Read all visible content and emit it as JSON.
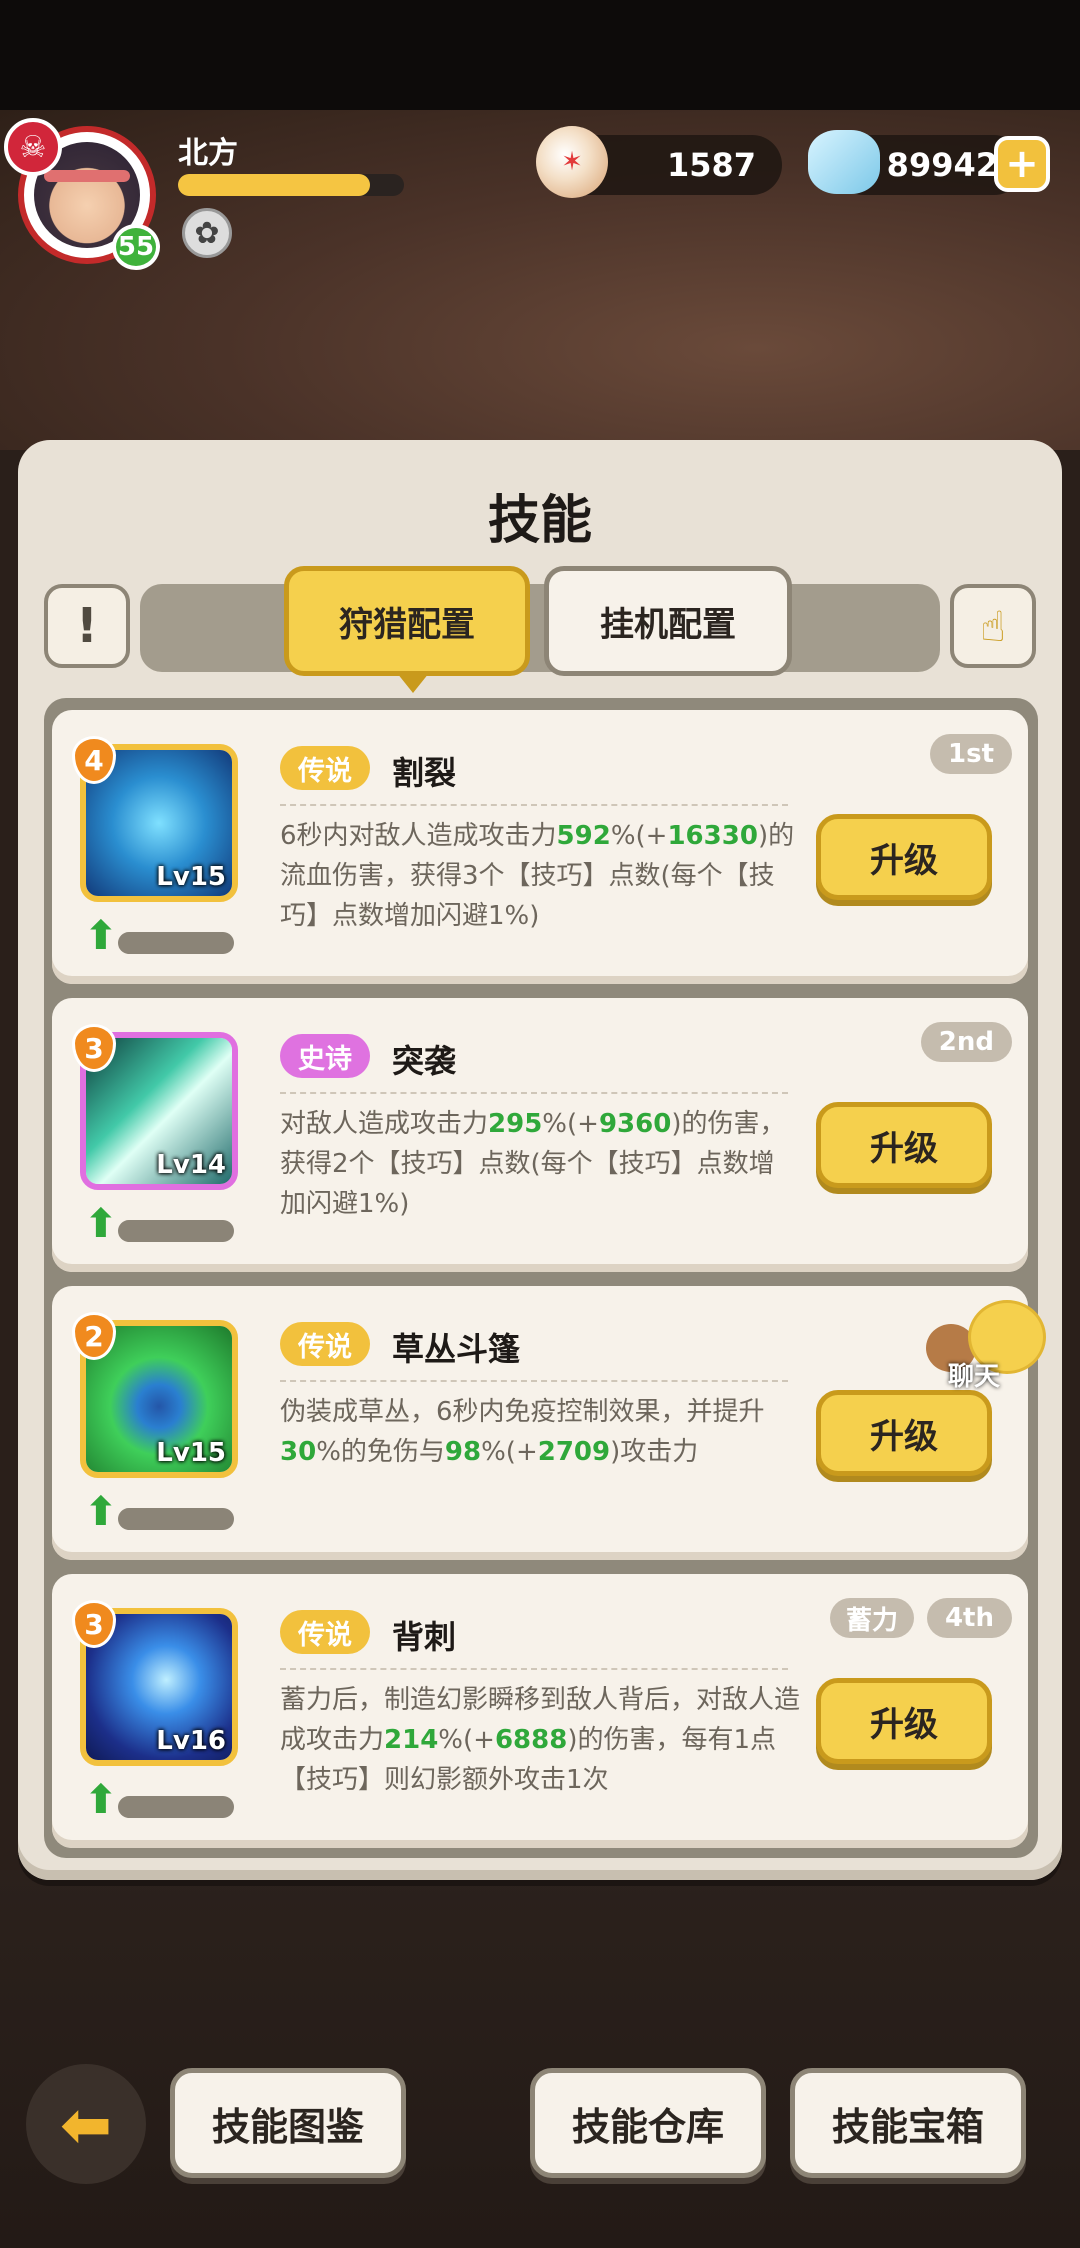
{
  "player": {
    "name": "北方",
    "level": "55",
    "xp_fraction": 0.85
  },
  "currencies": {
    "pearl": "1587",
    "gem": "89942"
  },
  "panel": {
    "title": "技能"
  },
  "tabs": {
    "hunt": "狩猎配置",
    "idle": "挂机配置"
  },
  "colors": {
    "legend": "#f2c13d",
    "epic": "#df72e0",
    "highlight": "#2fa83a"
  },
  "skills": [
    {
      "order": "1st",
      "charge": "",
      "stars": "4",
      "lv": "Lv15",
      "rarity": "传说",
      "name": "割裂",
      "desc": [
        "6秒内对敌人造成攻击力",
        "592",
        "%(+",
        "16330",
        ")的流血伤害，获得3个【技巧】点数(每个【技巧】点数增加闪避1%)"
      ],
      "upgrade": "升级",
      "progress": 0.0
    },
    {
      "order": "2nd",
      "charge": "",
      "stars": "3",
      "lv": "Lv14",
      "rarity": "史诗",
      "name": "突袭",
      "desc": [
        "对敌人造成攻击力",
        "295",
        "%(+",
        "9360",
        ")的伤害，获得2个【技巧】点数(每个【技巧】点数增加闪避1%)"
      ],
      "upgrade": "升级",
      "progress": 0.05
    },
    {
      "order": "",
      "charge": "",
      "stars": "2",
      "lv": "Lv15",
      "rarity": "传说",
      "name": "草丛斗篷",
      "desc_parts": [
        "伪装成草丛，6秒内免疫控制效果，并提升",
        "30",
        "%的免伤与",
        "98",
        "%(+",
        "2709",
        ")攻击力"
      ],
      "upgrade": "升级",
      "progress": 0.0
    },
    {
      "order": "4th",
      "charge": "蓄力",
      "stars": "3",
      "lv": "Lv16",
      "rarity": "传说",
      "name": "背刺",
      "desc": [
        "蓄力后，制造幻影瞬移到敌人背后，对敌人造成攻击力",
        "214",
        "%(+",
        "6888",
        ")的伤害，每有1点【技巧】则幻影额外攻击1次"
      ],
      "upgrade": "升级",
      "progress": 0.0
    }
  ],
  "chat": {
    "label": "聊天"
  },
  "bottom": {
    "codex": "技能图鉴",
    "warehouse": "技能仓库",
    "chest": "技能宝箱"
  }
}
